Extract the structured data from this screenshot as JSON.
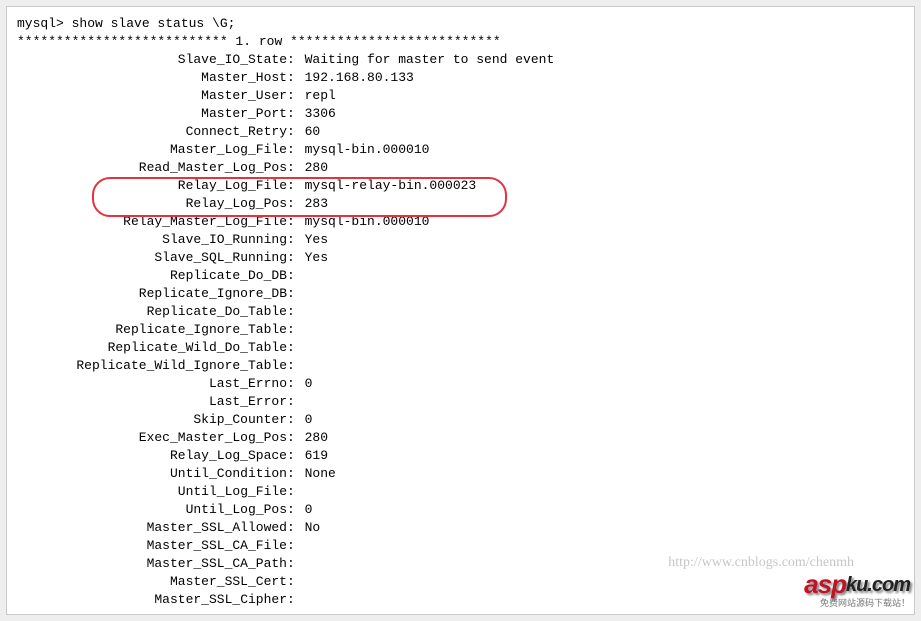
{
  "prompt_line": "mysql> show slave status \\G;",
  "row_header": "*************************** 1. row ***************************",
  "rows": [
    {
      "label": "Slave_IO_State",
      "value": "Waiting for master to send event"
    },
    {
      "label": "Master_Host",
      "value": "192.168.80.133"
    },
    {
      "label": "Master_User",
      "value": "repl"
    },
    {
      "label": "Master_Port",
      "value": "3306"
    },
    {
      "label": "Connect_Retry",
      "value": "60"
    },
    {
      "label": "Master_Log_File",
      "value": "mysql-bin.000010"
    },
    {
      "label": "Read_Master_Log_Pos",
      "value": "280"
    },
    {
      "label": "Relay_Log_File",
      "value": "mysql-relay-bin.000023"
    },
    {
      "label": "Relay_Log_Pos",
      "value": "283"
    },
    {
      "label": "Relay_Master_Log_File",
      "value": "mysql-bin.000010"
    },
    {
      "label": "Slave_IO_Running",
      "value": "Yes"
    },
    {
      "label": "Slave_SQL_Running",
      "value": "Yes"
    },
    {
      "label": "Replicate_Do_DB",
      "value": ""
    },
    {
      "label": "Replicate_Ignore_DB",
      "value": ""
    },
    {
      "label": "Replicate_Do_Table",
      "value": ""
    },
    {
      "label": "Replicate_Ignore_Table",
      "value": ""
    },
    {
      "label": "Replicate_Wild_Do_Table",
      "value": ""
    },
    {
      "label": "Replicate_Wild_Ignore_Table",
      "value": ""
    },
    {
      "label": "Last_Errno",
      "value": "0"
    },
    {
      "label": "Last_Error",
      "value": ""
    },
    {
      "label": "Skip_Counter",
      "value": "0"
    },
    {
      "label": "Exec_Master_Log_Pos",
      "value": "280"
    },
    {
      "label": "Relay_Log_Space",
      "value": "619"
    },
    {
      "label": "Until_Condition",
      "value": "None"
    },
    {
      "label": "Until_Log_File",
      "value": ""
    },
    {
      "label": "Until_Log_Pos",
      "value": "0"
    },
    {
      "label": "Master_SSL_Allowed",
      "value": "No"
    },
    {
      "label": "Master_SSL_CA_File",
      "value": ""
    },
    {
      "label": "Master_SSL_CA_Path",
      "value": ""
    },
    {
      "label": "Master_SSL_Cert",
      "value": ""
    },
    {
      "label": "Master_SSL_Cipher",
      "value": ""
    }
  ],
  "watermark": {
    "url": "http://www.cnblogs.com/chenmh",
    "logo_main": "asp",
    "logo_rest": "ku.com",
    "logo_sub": "免费网站源码下载站！"
  }
}
